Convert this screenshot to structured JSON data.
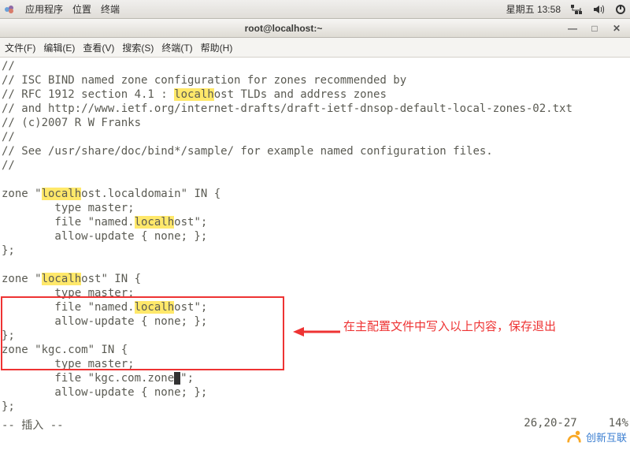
{
  "panel": {
    "apps": "应用程序",
    "places": "位置",
    "terminal": "终端",
    "clock": "星期五 13:58"
  },
  "window": {
    "title": "root@localhost:~"
  },
  "menubar": {
    "file": "文件(F)",
    "edit": "编辑(E)",
    "view": "查看(V)",
    "search": "搜索(S)",
    "terminal": "终端(T)",
    "help": "帮助(H)"
  },
  "editor": {
    "highlight_token": "localh",
    "lines": [
      "//",
      "// ISC BIND named zone configuration for zones recommended by",
      "// RFC 1912 section 4.1 : localhost TLDs and address zones",
      "// and http://www.ietf.org/internet-drafts/draft-ietf-dnsop-default-local-zones-02.txt",
      "// (c)2007 R W Franks",
      "//",
      "// See /usr/share/doc/bind*/sample/ for example named configuration files.",
      "//",
      "",
      "zone \"localhost.localdomain\" IN {",
      "        type master;",
      "        file \"named.localhost\";",
      "        allow-update { none; };",
      "};",
      "",
      "zone \"localhost\" IN {",
      "        type master;",
      "        file \"named.localhost\";",
      "        allow-update { none; };",
      "};",
      "zone \"kgc.com\" IN {",
      "        type master;",
      "        file \"kgc.com.zone\";",
      "        allow-update { none; };",
      "};"
    ],
    "mode": "-- 插入 --",
    "position": "26,20-27",
    "percent": "14%"
  },
  "annotation": {
    "text": "在主配置文件中写入以上内容，保存退出"
  },
  "watermark": {
    "text": "创新互联"
  }
}
